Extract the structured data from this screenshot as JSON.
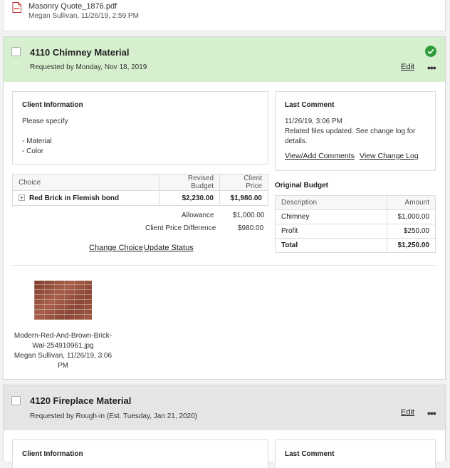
{
  "top_file": {
    "name": "Masonry Quote_1876.pdf",
    "meta": "Megan Sullivan, 11/26/19, 2:59 PM"
  },
  "card1": {
    "title": "4110 Chimney Material",
    "subtitle": "Requested by Monday, Nov 18, 2019",
    "edit": "Edit",
    "more": "•••",
    "status_color": "#2e9b3b",
    "client_info": {
      "title": "Client Information",
      "line1": "Please specify",
      "line2": "- Material",
      "line3": "- Color"
    },
    "last_comment": {
      "title": "Last Comment",
      "time": "11/26/19, 3:06 PM",
      "text1": "Related files updated. See change log for",
      "text2": "details.",
      "link1": "View/Add Comments",
      "link2": "View Change Log"
    },
    "choices": {
      "headers": [
        "Choice",
        "Revised Budget",
        "Client Price"
      ],
      "row": {
        "name": "Red Brick in Flemish bond",
        "budget": "$2,230.00",
        "price": "$1,980.00"
      }
    },
    "allowance_label": "Allowance",
    "allowance_value": "$1,000.00",
    "diff_label": "Client Price Difference",
    "diff_value": "$980.00",
    "change_choice": "Change Choice",
    "update_status": "Update Status",
    "original_budget": {
      "title": "Original Budget",
      "headers": [
        "Description",
        "Amount"
      ],
      "rows": [
        {
          "desc": "Chimney",
          "amount": "$1,000.00"
        },
        {
          "desc": "Profit",
          "amount": "$250.00"
        }
      ],
      "total_label": "Total",
      "total_value": "$1,250.00"
    },
    "attachment": {
      "line1": "Modern-Red-And-Brown-Brick-",
      "line2": "Wal-254910961.jpg",
      "line3": "Megan Sullivan, 11/26/19, 3:06",
      "line4": "PM"
    }
  },
  "card2": {
    "title": "4120 Fireplace Material",
    "subtitle": "Requested by Rough-in (Est. Tuesday, Jan 21, 2020)",
    "edit": "Edit",
    "more": "•••",
    "client_info_title": "Client Information",
    "last_comment_title": "Last Comment"
  }
}
